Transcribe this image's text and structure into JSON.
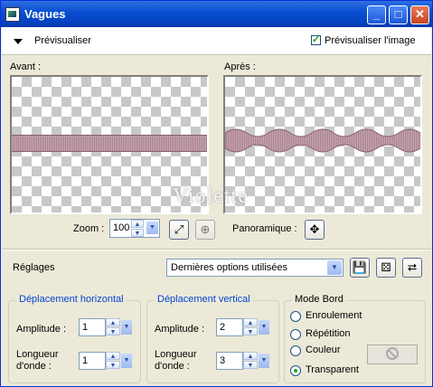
{
  "window": {
    "title": "Vagues",
    "minimize_glyph": "_",
    "maximize_glyph": "□",
    "close_glyph": "✕"
  },
  "preview": {
    "toggle_label": "Prévisualiser",
    "preview_image_label": "Prévisualiser l'image",
    "preview_image_checked": true
  },
  "panes": {
    "before_label": "Avant :",
    "after_label": "Après :",
    "watermark": "Violette"
  },
  "zoom": {
    "label": "Zoom :",
    "value": "100",
    "pan_label": "Panoramique :"
  },
  "settings": {
    "label": "Réglages",
    "preset_value": "Dernières options utilisées"
  },
  "horizontal": {
    "title": "Déplacement horizontal",
    "amplitude_label": "Amplitude :",
    "amplitude_value": "1",
    "wavelength_label_1": "Longueur",
    "wavelength_label_2": "d'onde :",
    "wavelength_value": "1"
  },
  "vertical": {
    "title": "Déplacement vertical",
    "amplitude_label": "Amplitude :",
    "amplitude_value": "2",
    "wavelength_label_1": "Longueur",
    "wavelength_label_2": "d'onde :",
    "wavelength_value": "3"
  },
  "edge_mode": {
    "title": "Mode Bord",
    "options": [
      "Enroulement",
      "Répétition",
      "Couleur",
      "Transparent"
    ],
    "selected": "Transparent"
  },
  "icons": {
    "pan": "move-icon",
    "fit": "zoom-fit-icon",
    "save": "save-preset-icon",
    "random": "dice-icon",
    "reset": "reset-icon",
    "none": "no-color-icon"
  }
}
